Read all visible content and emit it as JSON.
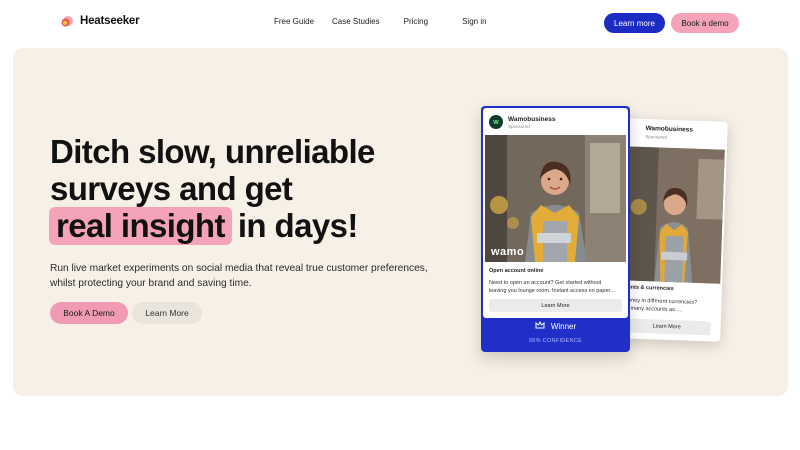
{
  "nav": {
    "logo_text": "Heatseeker",
    "links": [
      "Free Guide",
      "Case Studies",
      "Pricing",
      "Sign in"
    ],
    "learn_more": "Learn more",
    "book_demo": "Book a demo"
  },
  "hero": {
    "headline_line1": "Ditch slow, unreliable",
    "headline_line2": "surveys and get",
    "headline_highlight": "real insight",
    "headline_end": "in days!",
    "sub_line1": "Run live market experiments on social media that reveal true customer preferences,",
    "sub_line2": "whilst protecting your brand and saving time.",
    "cta_demo": "Book A Demo",
    "cta_more": "Learn More"
  },
  "ad_front": {
    "brand": "Wamobusiness",
    "sponsored": "Sponsored",
    "watermark": "wamo",
    "title": "Open account online",
    "body_line1": "Need to open an account? Get started without",
    "body_line2": "leaving you lounge room. Instant access no paper...",
    "button": "Learn More",
    "winner_label": "Winner",
    "confidence": "95% CONFIDENCE"
  },
  "ad_back": {
    "brand": "Wamobusiness",
    "sponsored": "Sponsored",
    "title": "ounts & currencies",
    "body_line1": "money in different currencies?",
    "body_line2": "as many accounts as.....",
    "button": "Learn More"
  },
  "colors": {
    "brand_blue": "#1b2bc4",
    "brand_pink": "#f4a3b8",
    "hero_bg": "#f6f0e6"
  }
}
